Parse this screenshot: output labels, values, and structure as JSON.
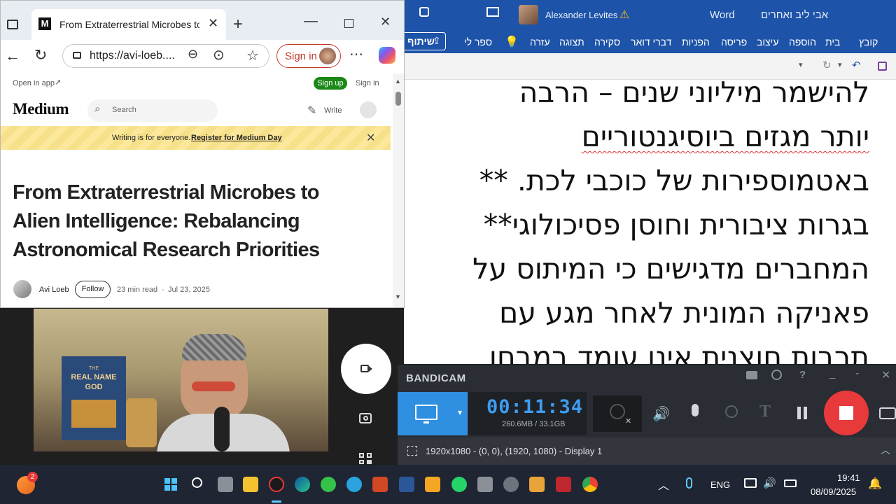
{
  "word": {
    "title": "אבי ליב ואחרים",
    "app_name": "Word",
    "user_name": "Alexander Levites",
    "ribbon_tabs": [
      "קובץ",
      "בית",
      "הוספה",
      "עיצוב",
      "פריסה",
      "הפניות",
      "דברי דואר",
      "סקירה",
      "תצוגה",
      "עזרה"
    ],
    "tell_me": "ספר לי",
    "share_label": "שיתוף",
    "doc_lines": [
      "להישמר מיליוני שנים – הרבה",
      "יותר מגזים ביוסיגנטוריים",
      "באטמוספירות של כוכבי לכת. **",
      "בגרות ציבורית וחוסן פסיכולוגי**",
      "המחברים מדגישים כי המיתוס על",
      "פאניקה המונית לאחר מגע עם",
      "תרבות חוצנית אינו עומד במבחן"
    ]
  },
  "browser": {
    "tab_title": "From Extraterrestrial Microbes to",
    "tab_favicon_text": "M",
    "url": "https://avi-loeb....",
    "sign_in_label": "Sign in",
    "page": {
      "open_in_app": "Open in app",
      "sign_up": "Sign up",
      "sign_in": "Sign in",
      "logo": "Medium",
      "search_placeholder": "Search",
      "write": "Write",
      "banner_text": "Writing is for everyone.",
      "banner_link": "Register for Medium Day",
      "article_title_lines": [
        "From Extraterrestrial Microbes to",
        "Alien Intelligence: Rebalancing",
        "Astronomical Research Priorities"
      ],
      "author": "Avi Loeb",
      "follow": "Follow",
      "read_time": "23 min read",
      "dot": "·",
      "date": "Jul 23, 2025"
    }
  },
  "webcam": {
    "book_line1": "THE",
    "book_line2": "REAL NAME",
    "book_line3": "GOD"
  },
  "bandicam": {
    "logo": "BANDICAM",
    "timer": "00:11:34",
    "storage": "260.6MB / 33.1GB",
    "display_info": "1920x1080 - (0, 0), (1920, 1080) - Display 1"
  },
  "taskbar": {
    "notification_count": "2",
    "language": "ENG",
    "time": "19:41",
    "date": "08/09/2025"
  },
  "colors": {
    "word_blue": "#1d53a8",
    "medium_green": "#1a8917",
    "banner_yellow": "#fbe89a",
    "bandicam_blue": "#2f8fe0",
    "record_red": "#e8393b",
    "timer_blue": "#3d9df0"
  }
}
